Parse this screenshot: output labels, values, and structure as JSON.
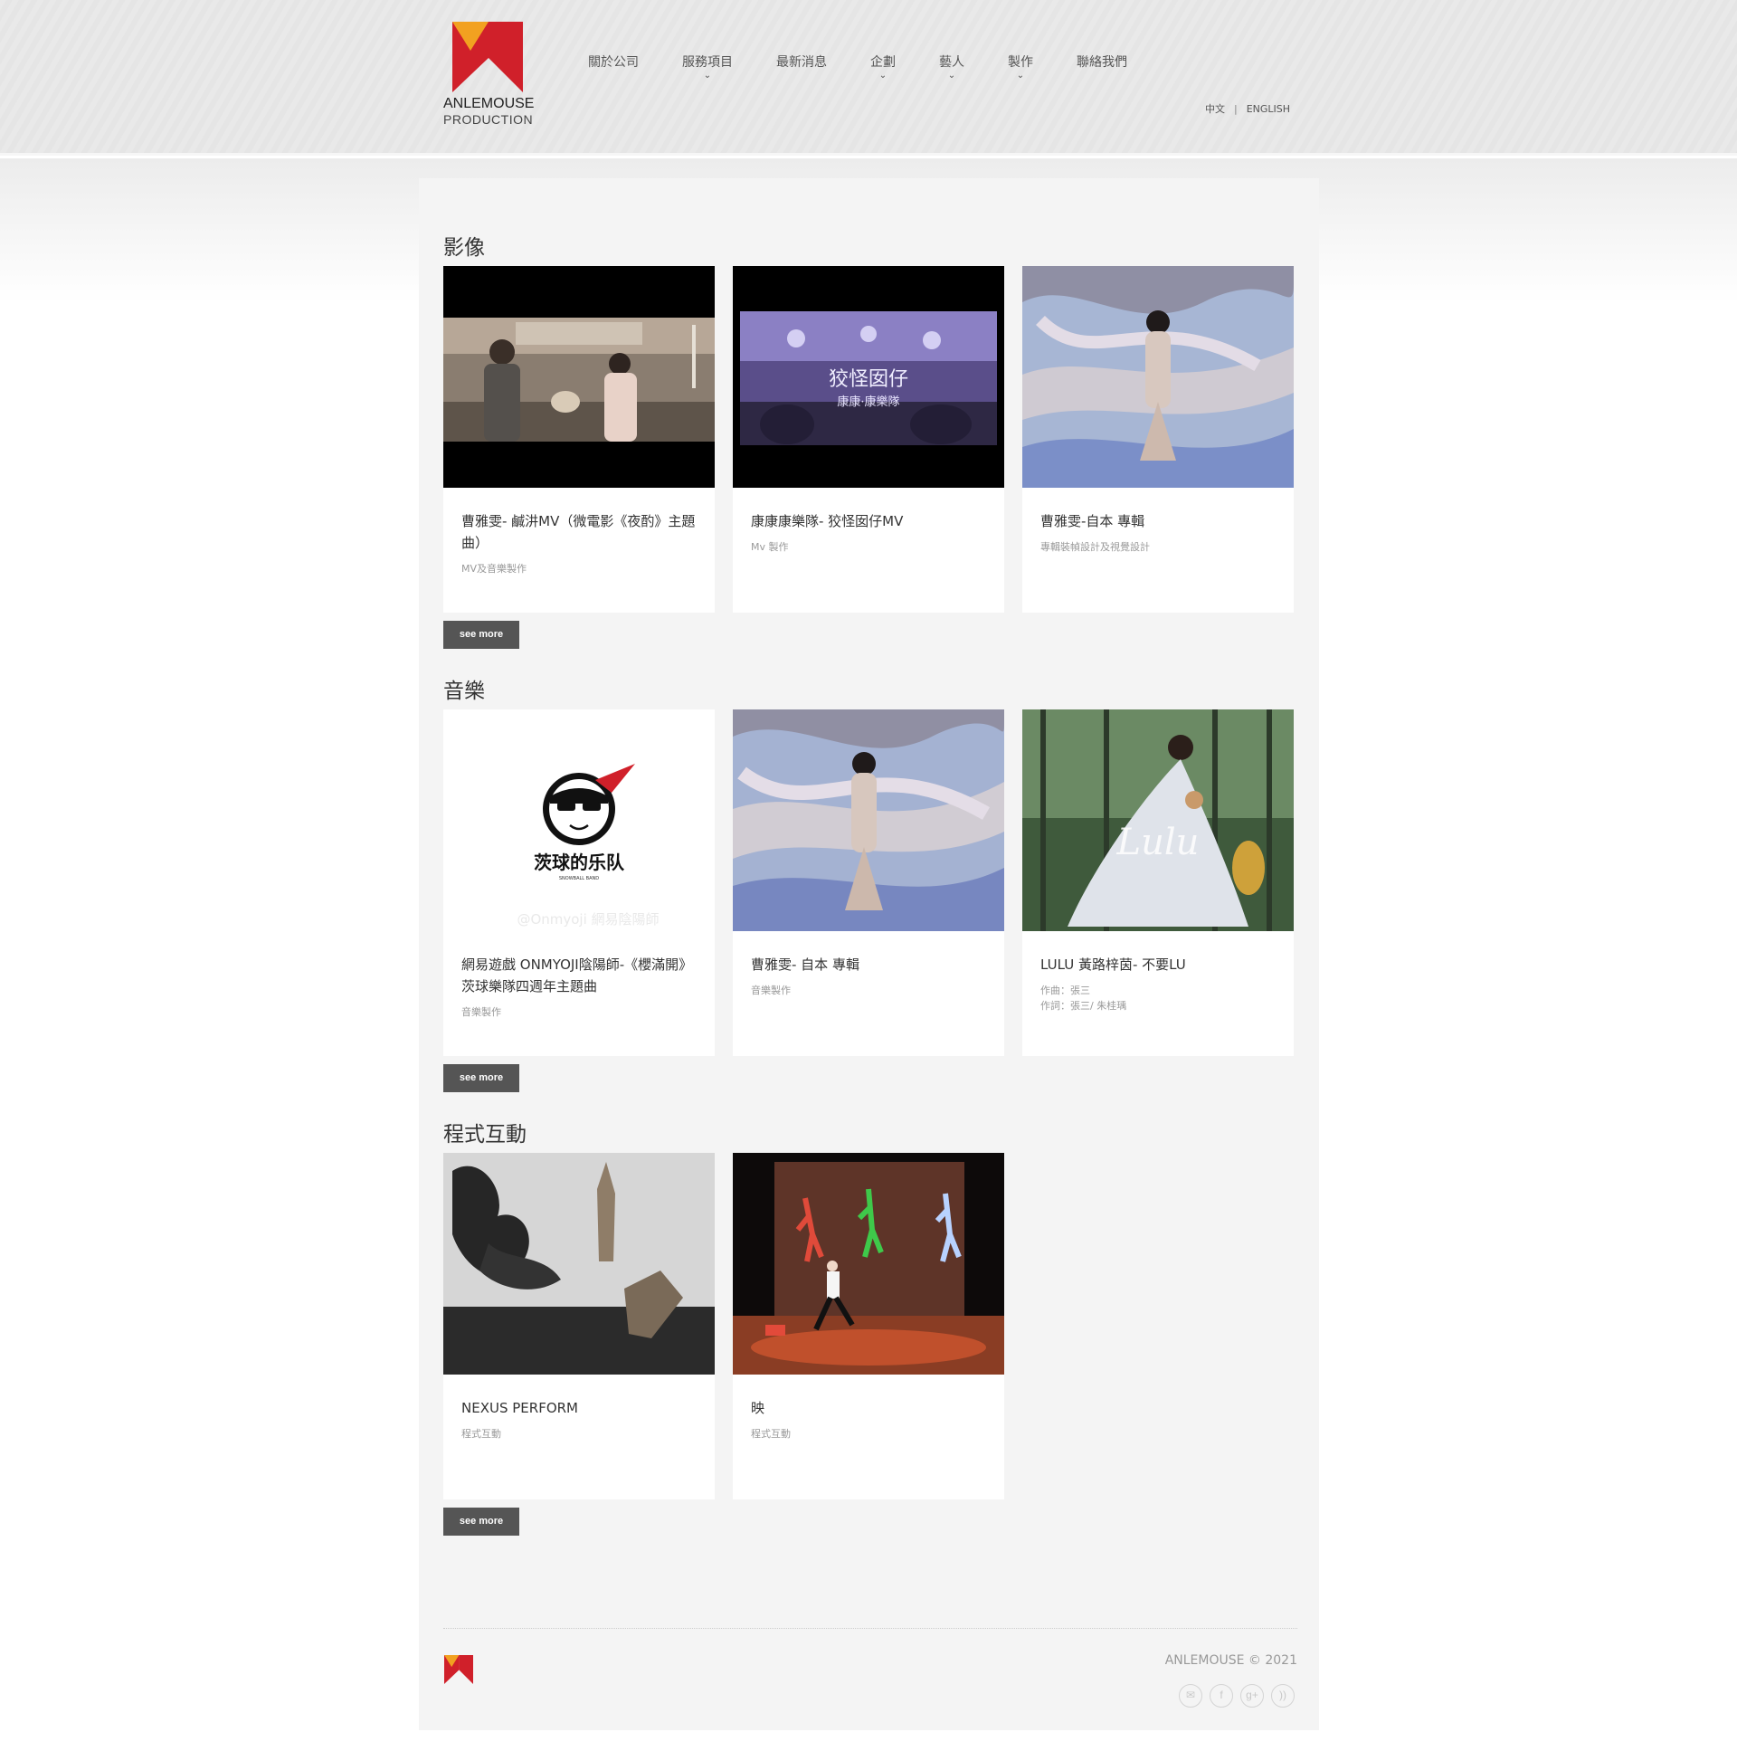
{
  "brand": {
    "name_line1": "ANLEMOUSE",
    "name_line2": "PRODUCTION"
  },
  "nav": {
    "items": [
      {
        "label": "關於公司",
        "has_dropdown": false
      },
      {
        "label": "服務項目",
        "has_dropdown": true
      },
      {
        "label": "最新消息",
        "has_dropdown": false
      },
      {
        "label": "企劃",
        "has_dropdown": true
      },
      {
        "label": "藝人",
        "has_dropdown": true
      },
      {
        "label": "製作",
        "has_dropdown": true
      },
      {
        "label": "聯絡我們",
        "has_dropdown": false
      }
    ],
    "chevron": "⌄"
  },
  "lang": {
    "zh": "中文",
    "sep": "|",
    "en": "ENGLISH"
  },
  "sections": [
    {
      "title": "影像",
      "see_more": "see more",
      "cards": [
        {
          "title": "曹雅雯- 鹹汫MV（微電影《夜酌》主題曲）",
          "sub": "MV及音樂製作"
        },
        {
          "title": "康康康樂隊- 狡怪囡仔MV",
          "sub": "Mv 製作"
        },
        {
          "title": "曹雅雯-自本 專輯",
          "sub": "專輯裝幀設計及視覺設計"
        }
      ]
    },
    {
      "title": "音樂",
      "see_more": "see more",
      "cards": [
        {
          "title": "網易遊戲 ONMYOJI陰陽師-《櫻滿開》茨球樂隊四週年主題曲",
          "sub": "音樂製作"
        },
        {
          "title": "曹雅雯- 自本 專輯",
          "sub": "音樂製作"
        },
        {
          "title": "LULU 黃路梓茵- 不要LU",
          "sub": "作曲：張三",
          "sub2": "作詞：張三/ 朱桂瑀"
        }
      ]
    },
    {
      "title": "程式互動",
      "see_more": "see more",
      "cards": [
        {
          "title": "NEXUS PERFORM",
          "sub": "程式互動"
        },
        {
          "title": "映",
          "sub": "程式互動"
        }
      ]
    }
  ],
  "thumb_text": {
    "mv_title": "狡怪囡仔",
    "mv_band": "康康·康樂隊",
    "band_logo": "茨球的乐队",
    "band_logo_small": "SNOWBALL BAND",
    "watermark": "@Onmyoji 網易陰陽師",
    "signature": "Lulu"
  },
  "footer": {
    "copyright": "ANLEMOUSE © 2021"
  },
  "socials": [
    {
      "icon": "mail-icon",
      "glyph": "✉"
    },
    {
      "icon": "facebook-icon",
      "glyph": "f"
    },
    {
      "icon": "google-plus-icon",
      "glyph": "g+"
    },
    {
      "icon": "rss-icon",
      "glyph": "))"
    }
  ],
  "colors": {
    "brand_red": "#d0202a",
    "brand_orange": "#f2a120",
    "button": "#555555"
  }
}
